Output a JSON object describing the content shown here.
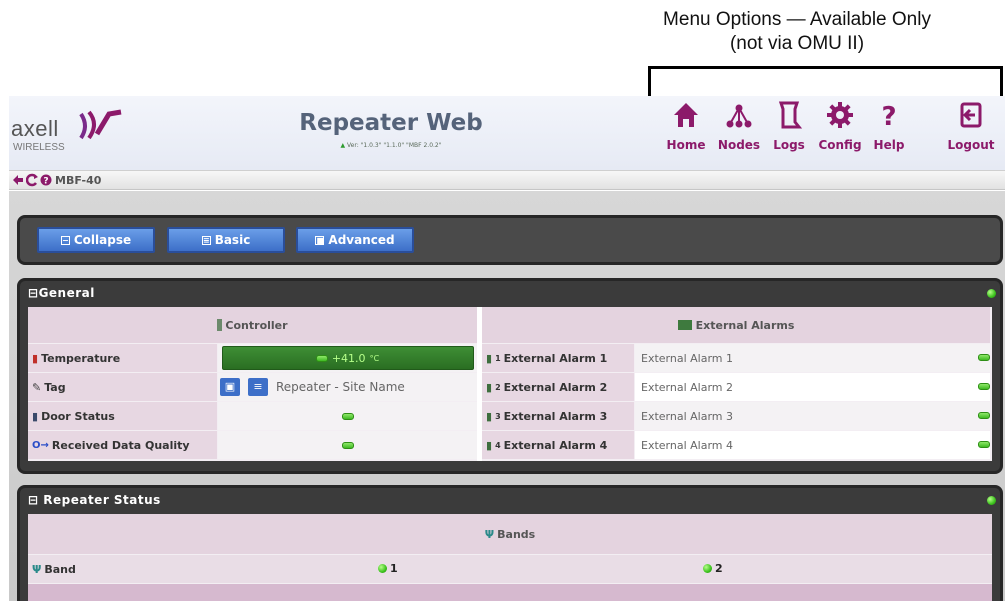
{
  "annotation": {
    "line1": "Menu Options — Available Only",
    "line2": "(not via OMU II)"
  },
  "header": {
    "logo_text": "axell",
    "logo_sub": "WIRELESS",
    "title": "Repeater Web",
    "version": "Ver: \"1.0.3\" \"1.1.0\" \"MBF 2.0.2\""
  },
  "nav": [
    {
      "label": "Home",
      "icon": "home-icon"
    },
    {
      "label": "Nodes",
      "icon": "nodes-icon"
    },
    {
      "label": "Logs",
      "icon": "logs-icon"
    },
    {
      "label": "Config",
      "icon": "config-icon"
    },
    {
      "label": "Help",
      "icon": "help-icon"
    },
    {
      "label": "Logout",
      "icon": "logout-icon"
    }
  ],
  "breadcrumb": {
    "device": "MBF-40"
  },
  "toolbar": {
    "collapse": "Collapse",
    "basic": "Basic",
    "advanced": "Advanced"
  },
  "general": {
    "title": "General",
    "controller_header": "Controller",
    "alarms_header": "External Alarms",
    "rows": [
      {
        "label": "Temperature",
        "value": "+41.0",
        "unit": "°C"
      },
      {
        "label": "Tag",
        "value": "Repeater - Site Name"
      },
      {
        "label": "Door Status"
      },
      {
        "label": "Received Data Quality"
      }
    ],
    "alarms": [
      {
        "num": "1",
        "label": "External Alarm 1",
        "value": "External Alarm 1"
      },
      {
        "num": "2",
        "label": "External Alarm 2",
        "value": "External Alarm 2"
      },
      {
        "num": "3",
        "label": "External Alarm 3",
        "value": "External Alarm 3"
      },
      {
        "num": "4",
        "label": "External Alarm 4",
        "value": "External Alarm 4"
      }
    ]
  },
  "repeater_status": {
    "title": "Repeater Status",
    "bands_header": "Bands",
    "band_label": "Band",
    "bands": [
      "1",
      "2"
    ]
  },
  "colors": {
    "accent": "#8c1a6a",
    "button": "#3d6fc8",
    "status_ok": "#3bc11c"
  }
}
